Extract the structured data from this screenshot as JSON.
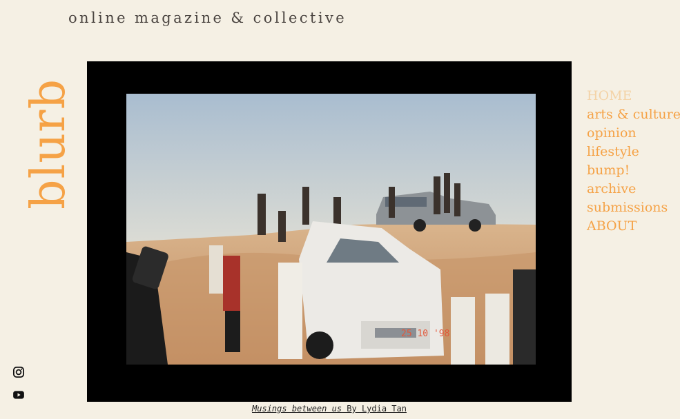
{
  "header": {
    "tagline": "online magazine & collective"
  },
  "logo": {
    "text": "blurb"
  },
  "feature": {
    "photo_date_stamp": "25 10 '98",
    "caption_title": "Musings between us",
    "caption_byline": " By Lydia Tan"
  },
  "nav": {
    "items": [
      {
        "label": "HOME",
        "active": true
      },
      {
        "label": "arts & culture"
      },
      {
        "label": "opinion"
      },
      {
        "label": "lifestyle"
      },
      {
        "label": "bump!"
      },
      {
        "label": "archive"
      },
      {
        "label": "submissions"
      },
      {
        "label": "ABOUT"
      }
    ]
  },
  "social": {
    "icons": [
      "instagram-icon",
      "youtube-icon"
    ]
  },
  "colors": {
    "background": "#f5f0e4",
    "accent": "#f5a246",
    "active_nav": "#f4d3a7",
    "frame": "#000000"
  }
}
